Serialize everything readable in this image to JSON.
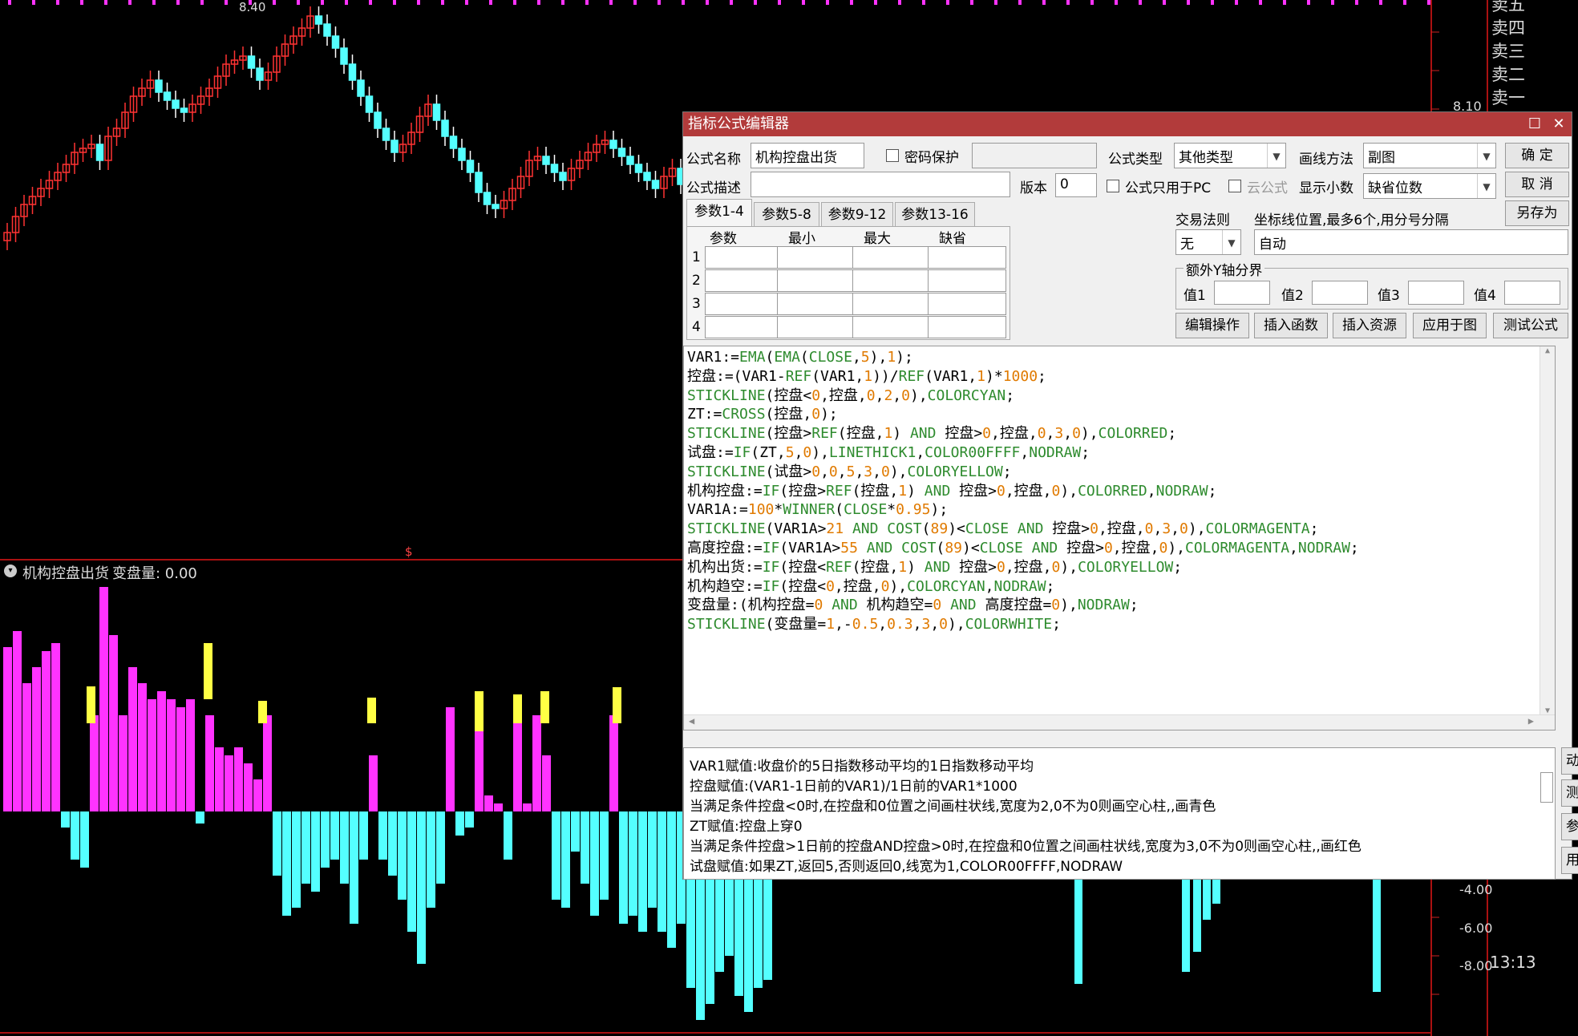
{
  "chart": {
    "price_high_label": "8.40",
    "price_axis_label": "8.10",
    "sub_indicator_name": "机构控盘出货",
    "sub_indicator_value": "变盘量: 0.00",
    "sub_axis_labels": [
      "-4.00",
      "-6.00",
      "-8.00"
    ],
    "order_book": [
      "卖五",
      "卖四",
      "卖三",
      "卖二",
      "卖一"
    ],
    "time": "13:13",
    "dollar_mark": "$",
    "colors": {
      "up": "#ff3333",
      "down": "#54ffff",
      "magenta": "#ff33ff",
      "yellow": "#ffff44"
    }
  },
  "dialog": {
    "title": "指标公式编辑器",
    "formula_name_label": "公式名称",
    "formula_name": "机构控盘出货",
    "password_label": "密码保护",
    "formula_type_label": "公式类型",
    "formula_type": "其他类型",
    "draw_method_label": "画线方法",
    "draw_method": "副图",
    "ok_button": "确  定",
    "cancel_button": "取  消",
    "save_as_button": "另存为",
    "desc_label": "公式描述",
    "version_label": "版本",
    "version": "0",
    "pc_only_label": "公式只用于PC",
    "cloud_label": "云公式",
    "decimals_label": "显示小数",
    "decimals": "缺省位数",
    "tabs": [
      "参数1-4",
      "参数5-8",
      "参数9-12",
      "参数13-16"
    ],
    "param_headers": [
      "参数",
      "最小",
      "最大",
      "缺省"
    ],
    "param_rows": [
      "1",
      "2",
      "3",
      "4"
    ],
    "trade_rule_label": "交易法则",
    "trade_rule": "无",
    "coord_label": "坐标线位置,最多6个,用分号分隔",
    "coord_value": "自动",
    "extra_y_label": "额外Y轴分界",
    "y_values": [
      "值1",
      "值2",
      "值3",
      "值4"
    ],
    "action_buttons": [
      "编辑操作",
      "插入函数",
      "插入资源",
      "应用于图",
      "测试公式"
    ],
    "side_buttons": [
      "动态翻译",
      "测试结果",
      "参数精灵",
      "用法注释"
    ],
    "translation_lines": [
      "VAR1赋值:收盘价的5日指数移动平均的1日指数移动平均",
      "控盘赋值:(VAR1-1日前的VAR1)/1日前的VAR1*1000",
      "当满足条件控盘<0时,在控盘和0位置之间画柱状线,宽度为2,0不为0则画空心柱,,画青色",
      "ZT赋值:控盘上穿0",
      "当满足条件控盘>1日前的控盘AND控盘>0时,在控盘和0位置之间画柱状线,宽度为3,0不为0则画空心柱,,画红色",
      "试盘赋值:如果ZT,返回5,否则返回0,线宽为1,COLOR00FFFF,NODRAW"
    ],
    "code_lines": [
      [
        [
          "v",
          "VAR1:="
        ],
        [
          "k",
          "EMA"
        ],
        [
          "v",
          "("
        ],
        [
          "k",
          "EMA"
        ],
        [
          "v",
          "("
        ],
        [
          "k",
          "CLOSE"
        ],
        [
          "v",
          ","
        ],
        [
          "n",
          "5"
        ],
        [
          "v",
          "),"
        ],
        [
          "n",
          "1"
        ],
        [
          "v",
          ");"
        ]
      ],
      [
        [
          "v",
          "控盘:=(VAR1-"
        ],
        [
          "k",
          "REF"
        ],
        [
          "v",
          "(VAR1,"
        ],
        [
          "n",
          "1"
        ],
        [
          "v",
          "))/"
        ],
        [
          "k",
          "REF"
        ],
        [
          "v",
          "(VAR1,"
        ],
        [
          "n",
          "1"
        ],
        [
          "v",
          ")*"
        ],
        [
          "n",
          "1000"
        ],
        [
          "v",
          ";"
        ]
      ],
      [
        [
          "k",
          "STICKLINE"
        ],
        [
          "v",
          "(控盘<"
        ],
        [
          "n",
          "0"
        ],
        [
          "v",
          ",控盘,"
        ],
        [
          "n",
          "0"
        ],
        [
          "v",
          ","
        ],
        [
          "n",
          "2"
        ],
        [
          "v",
          ","
        ],
        [
          "n",
          "0"
        ],
        [
          "v",
          "),"
        ],
        [
          "k",
          "COLORCYAN"
        ],
        [
          "v",
          ";"
        ]
      ],
      [
        [
          "v",
          "ZT:="
        ],
        [
          "k",
          "CROSS"
        ],
        [
          "v",
          "(控盘,"
        ],
        [
          "n",
          "0"
        ],
        [
          "v",
          ");"
        ]
      ],
      [
        [
          "k",
          "STICKLINE"
        ],
        [
          "v",
          "(控盘>"
        ],
        [
          "k",
          "REF"
        ],
        [
          "v",
          "(控盘,"
        ],
        [
          "n",
          "1"
        ],
        [
          "v",
          ") "
        ],
        [
          "k",
          "AND"
        ],
        [
          "v",
          " 控盘>"
        ],
        [
          "n",
          "0"
        ],
        [
          "v",
          ",控盘,"
        ],
        [
          "n",
          "0"
        ],
        [
          "v",
          ","
        ],
        [
          "n",
          "3"
        ],
        [
          "v",
          ","
        ],
        [
          "n",
          "0"
        ],
        [
          "v",
          "),"
        ],
        [
          "k",
          "COLORRED"
        ],
        [
          "v",
          ";"
        ]
      ],
      [
        [
          "v",
          "试盘:="
        ],
        [
          "k",
          "IF"
        ],
        [
          "v",
          "(ZT,"
        ],
        [
          "n",
          "5"
        ],
        [
          "v",
          ","
        ],
        [
          "n",
          "0"
        ],
        [
          "v",
          "),"
        ],
        [
          "k",
          "LINETHICK1"
        ],
        [
          "v",
          ","
        ],
        [
          "k",
          "COLOR00FFFF"
        ],
        [
          "v",
          ","
        ],
        [
          "k",
          "NODRAW"
        ],
        [
          "v",
          ";"
        ]
      ],
      [
        [
          "k",
          "STICKLINE"
        ],
        [
          "v",
          "(试盘>"
        ],
        [
          "n",
          "0"
        ],
        [
          "v",
          ","
        ],
        [
          "n",
          "0"
        ],
        [
          "v",
          ","
        ],
        [
          "n",
          "5"
        ],
        [
          "v",
          ","
        ],
        [
          "n",
          "3"
        ],
        [
          "v",
          ","
        ],
        [
          "n",
          "0"
        ],
        [
          "v",
          "),"
        ],
        [
          "k",
          "COLORYELLOW"
        ],
        [
          "v",
          ";"
        ]
      ],
      [
        [
          "v",
          "机构控盘:="
        ],
        [
          "k",
          "IF"
        ],
        [
          "v",
          "(控盘>"
        ],
        [
          "k",
          "REF"
        ],
        [
          "v",
          "(控盘,"
        ],
        [
          "n",
          "1"
        ],
        [
          "v",
          ") "
        ],
        [
          "k",
          "AND"
        ],
        [
          "v",
          " 控盘>"
        ],
        [
          "n",
          "0"
        ],
        [
          "v",
          ",控盘,"
        ],
        [
          "n",
          "0"
        ],
        [
          "v",
          "),"
        ],
        [
          "k",
          "COLORRED"
        ],
        [
          "v",
          ","
        ],
        [
          "k",
          "NODRAW"
        ],
        [
          "v",
          ";"
        ]
      ],
      [
        [
          "v",
          "VAR1A:="
        ],
        [
          "n",
          "100"
        ],
        [
          "v",
          "*"
        ],
        [
          "k",
          "WINNER"
        ],
        [
          "v",
          "("
        ],
        [
          "k",
          "CLOSE"
        ],
        [
          "v",
          "*"
        ],
        [
          "n",
          "0.95"
        ],
        [
          "v",
          ");"
        ]
      ],
      [
        [
          "k",
          "STICKLINE"
        ],
        [
          "v",
          "(VAR1A>"
        ],
        [
          "n",
          "21"
        ],
        [
          "v",
          " "
        ],
        [
          "k",
          "AND"
        ],
        [
          "v",
          " "
        ],
        [
          "k",
          "COST"
        ],
        [
          "v",
          "("
        ],
        [
          "n",
          "89"
        ],
        [
          "v",
          ")<"
        ],
        [
          "k",
          "CLOSE"
        ],
        [
          "v",
          " "
        ],
        [
          "k",
          "AND"
        ],
        [
          "v",
          " 控盘>"
        ],
        [
          "n",
          "0"
        ],
        [
          "v",
          ",控盘,"
        ],
        [
          "n",
          "0"
        ],
        [
          "v",
          ","
        ],
        [
          "n",
          "3"
        ],
        [
          "v",
          ","
        ],
        [
          "n",
          "0"
        ],
        [
          "v",
          "),"
        ],
        [
          "k",
          "COLORMAGENTA"
        ],
        [
          "v",
          ";"
        ]
      ],
      [
        [
          "v",
          "高度控盘:="
        ],
        [
          "k",
          "IF"
        ],
        [
          "v",
          "(VAR1A>"
        ],
        [
          "n",
          "55"
        ],
        [
          "v",
          " "
        ],
        [
          "k",
          "AND"
        ],
        [
          "v",
          " "
        ],
        [
          "k",
          "COST"
        ],
        [
          "v",
          "("
        ],
        [
          "n",
          "89"
        ],
        [
          "v",
          ")<"
        ],
        [
          "k",
          "CLOSE"
        ],
        [
          "v",
          " "
        ],
        [
          "k",
          "AND"
        ],
        [
          "v",
          " 控盘>"
        ],
        [
          "n",
          "0"
        ],
        [
          "v",
          ",控盘,"
        ],
        [
          "n",
          "0"
        ],
        [
          "v",
          "),"
        ],
        [
          "k",
          "COLORMAGENTA"
        ],
        [
          "v",
          ","
        ],
        [
          "k",
          "NODRAW"
        ],
        [
          "v",
          ";"
        ]
      ],
      [
        [
          "v",
          "机构出货:="
        ],
        [
          "k",
          "IF"
        ],
        [
          "v",
          "(控盘<"
        ],
        [
          "k",
          "REF"
        ],
        [
          "v",
          "(控盘,"
        ],
        [
          "n",
          "1"
        ],
        [
          "v",
          ") "
        ],
        [
          "k",
          "AND"
        ],
        [
          "v",
          " 控盘>"
        ],
        [
          "n",
          "0"
        ],
        [
          "v",
          ",控盘,"
        ],
        [
          "n",
          "0"
        ],
        [
          "v",
          "),"
        ],
        [
          "k",
          "COLORYELLOW"
        ],
        [
          "v",
          ";"
        ]
      ],
      [
        [
          "v",
          "机构趋空:="
        ],
        [
          "k",
          "IF"
        ],
        [
          "v",
          "(控盘<"
        ],
        [
          "n",
          "0"
        ],
        [
          "v",
          ",控盘,"
        ],
        [
          "n",
          "0"
        ],
        [
          "v",
          "),"
        ],
        [
          "k",
          "COLORCYAN"
        ],
        [
          "v",
          ","
        ],
        [
          "k",
          "NODRAW"
        ],
        [
          "v",
          ";"
        ]
      ],
      [
        [
          "v",
          "变盘量:(机构控盘="
        ],
        [
          "n",
          "0"
        ],
        [
          "v",
          " "
        ],
        [
          "k",
          "AND"
        ],
        [
          "v",
          " 机构趋空="
        ],
        [
          "n",
          "0"
        ],
        [
          "v",
          " "
        ],
        [
          "k",
          "AND"
        ],
        [
          "v",
          " 高度控盘="
        ],
        [
          "n",
          "0"
        ],
        [
          "v",
          "),"
        ],
        [
          "k",
          "NODRAW"
        ],
        [
          "v",
          ";"
        ]
      ],
      [
        [
          "k",
          "STICKLINE"
        ],
        [
          "v",
          "(变盘量="
        ],
        [
          "n",
          "1"
        ],
        [
          "v",
          ",-"
        ],
        [
          "n",
          "0.5"
        ],
        [
          "v",
          ","
        ],
        [
          "n",
          "0.3"
        ],
        [
          "v",
          ","
        ],
        [
          "n",
          "3"
        ],
        [
          "v",
          ","
        ],
        [
          "n",
          "0"
        ],
        [
          "v",
          "),"
        ],
        [
          "k",
          "COLORWHITE"
        ],
        [
          "v",
          ";"
        ]
      ]
    ]
  }
}
